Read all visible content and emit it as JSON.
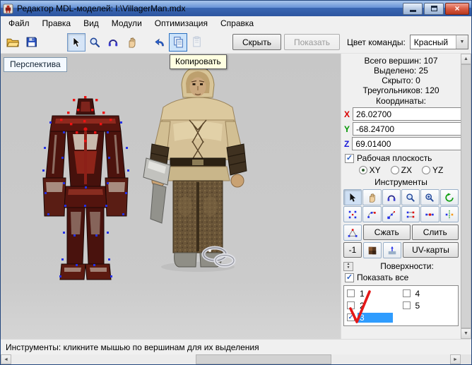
{
  "titlebar": {
    "title": "Редактор MDL-моделей: I:\\VillagerMan.mdx"
  },
  "menu": {
    "items": [
      "Файл",
      "Правка",
      "Вид",
      "Модули",
      "Оптимизация",
      "Справка"
    ]
  },
  "toolbar": {
    "hide": "Скрыть",
    "show": "Показать",
    "team_color_label": "Цвет команды:",
    "team_color_value": "Красный",
    "tooltip_copy": "Копировать"
  },
  "viewport": {
    "tab": "Перспектива"
  },
  "panel": {
    "stats": {
      "total": "Всего вершин: 107",
      "selected": "Выделено: 25",
      "hidden": "Скрыто: 0",
      "triangles": "Треугольников: 120"
    },
    "coords": {
      "label": "Координаты:",
      "x": {
        "label": "X",
        "value": "26.02700"
      },
      "y": {
        "label": "Y",
        "value": "-68.24700"
      },
      "z": {
        "label": "Z",
        "value": "69.01400"
      }
    },
    "workplane": {
      "label": "Рабочая плоскость",
      "options": [
        "XY",
        "ZX",
        "YZ"
      ],
      "selected": "XY"
    },
    "tools": {
      "label": "Инструменты",
      "compress": "Сжать",
      "merge": "Слить",
      "minus_one": "-1",
      "uv_maps": "UV-карты"
    },
    "surfaces": {
      "label": "Поверхности:",
      "show_all": "Показать все",
      "items": [
        {
          "label": "1",
          "checked": false,
          "selected": false
        },
        {
          "label": "2",
          "checked": false,
          "selected": false
        },
        {
          "label": "3",
          "checked": true,
          "selected": true
        },
        {
          "label": "4",
          "checked": false,
          "selected": false
        },
        {
          "label": "5",
          "checked": false,
          "selected": false
        }
      ]
    }
  },
  "statusbar": {
    "text": "Инструменты: кликните мышью по вершинам для их выделения"
  },
  "colors": {
    "x_axis": "#d80000",
    "y_axis": "#009600",
    "z_axis": "#1a1ad8",
    "selection": "#2f9cfe",
    "selected_vertex": "#f01212",
    "vertex": "#2431e8",
    "viewport_bg": "#c9c9c9",
    "tooltip_bg": "#ffffe1"
  }
}
